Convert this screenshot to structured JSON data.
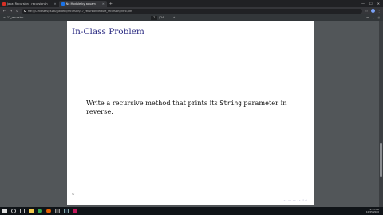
{
  "browser": {
    "tabs": [
      {
        "title": "Java: Recursion - recursionsh",
        "active": false
      },
      {
        "title": "No Module by aquam",
        "active": true
      }
    ],
    "new_tab_label": "+",
    "window_controls": {
      "minimize": "—",
      "maximize": "☐",
      "close": "✕"
    },
    "address": "file:///C:/classes/cs180_javafall/recursion/17_recursion/lecture_recursion_intro.pdf"
  },
  "pdf_toolbar": {
    "menu_icon": "menu-icon",
    "filename": "17_recursion",
    "page_current": "7",
    "page_total": "/ 24",
    "zoom_out": "–",
    "zoom_in": "+",
    "rotate": "⟳",
    "download": "⤓",
    "print": "⎙"
  },
  "slide": {
    "title": "In-Class Problem",
    "body_before": "Write a recursive method that prints its ",
    "body_code": "String",
    "body_after": " parameter in reverse.",
    "nav_icons": "◂ ▸ ◂ ▸ ◂ ▸ ◂ ▸ ↺ ⟲"
  },
  "taskbar": {
    "time": "11:53 AM",
    "date": "10/25/2020",
    "icons": [
      "start-icon",
      "search-icon",
      "task-view-icon",
      "file-explorer-icon",
      "chrome-icon",
      "firefox-icon",
      "terminal-icon",
      "steam-icon",
      "intellij-icon"
    ]
  },
  "colors": {
    "slide_title": "#2c2c83",
    "viewer_bg": "#525659",
    "chrome_dark": "#202124"
  }
}
